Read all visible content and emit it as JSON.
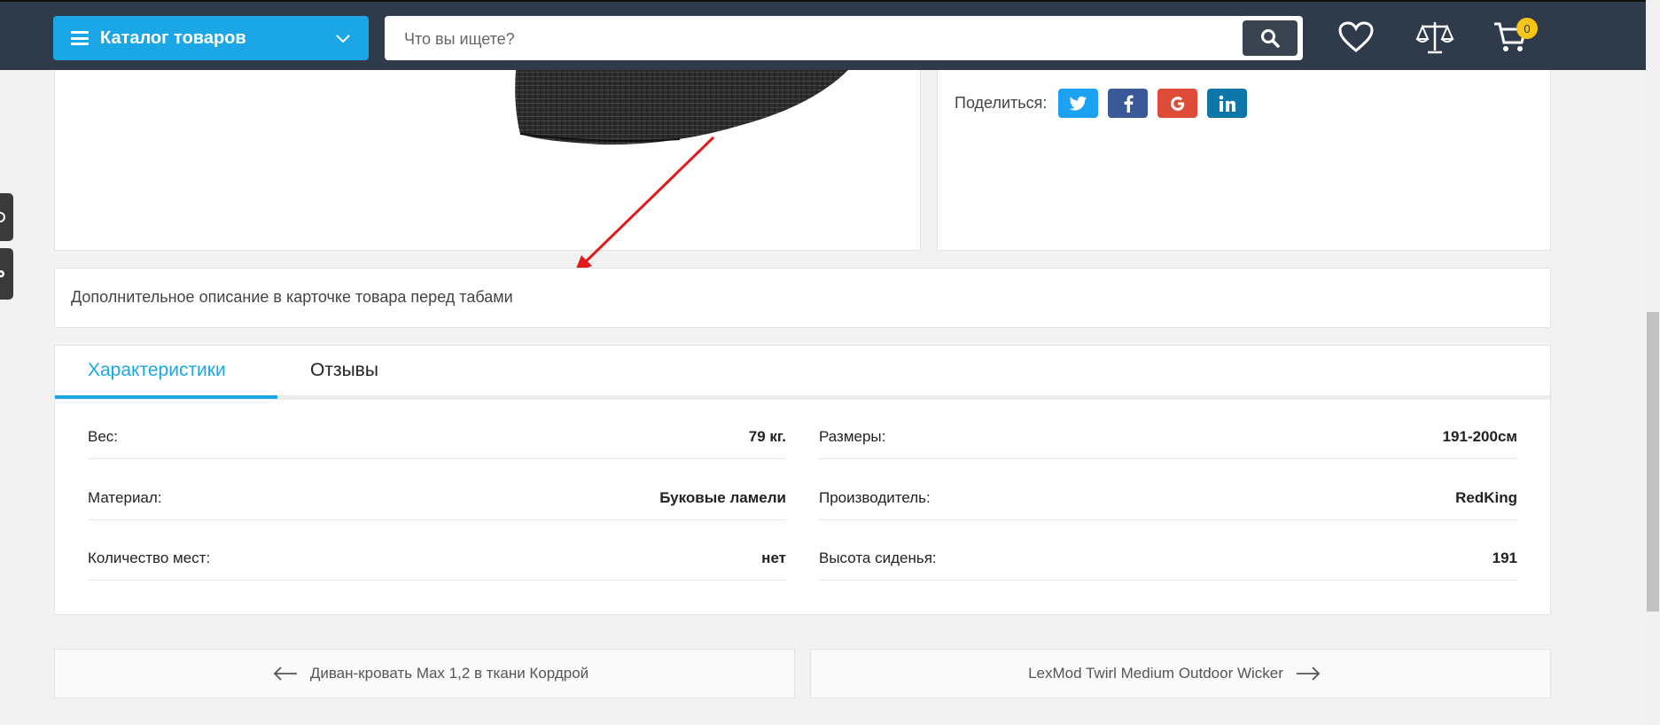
{
  "header": {
    "catalog_label": "Каталог товаров",
    "search_placeholder": "Что вы ищете?",
    "cart_count": "0",
    "accent_color": "#1ba7e6",
    "bg_color": "#2f3b4b",
    "icons": [
      "menu-icon",
      "chevron-down-icon",
      "search-icon",
      "heart-icon",
      "compare-scales-icon",
      "cart-icon"
    ]
  },
  "share": {
    "label": "Поделиться:",
    "buttons": [
      {
        "name": "twitter",
        "color": "#1da1f2"
      },
      {
        "name": "facebook",
        "color": "#3b5998"
      },
      {
        "name": "google",
        "color": "#dd4b39"
      },
      {
        "name": "linkedin",
        "color": "#0e76a8"
      }
    ]
  },
  "description": {
    "text": "Дополнительное описание в карточке товара перед табами"
  },
  "tabs": [
    {
      "label": "Характеристики",
      "active": true
    },
    {
      "label": "Отзывы",
      "active": false
    }
  ],
  "specs": {
    "left": [
      {
        "name": "Вес:",
        "value": "79 кг."
      },
      {
        "name": "Материал:",
        "value": "Буковые ламели"
      },
      {
        "name": "Количество мест:",
        "value": "нет"
      }
    ],
    "right": [
      {
        "name": "Размеры:",
        "value": "191-200см"
      },
      {
        "name": "Производитель:",
        "value": "RedKing"
      },
      {
        "name": "Высота сиденья:",
        "value": "191"
      }
    ]
  },
  "pager": {
    "prev": "Диван-кровать Max 1,2 в ткани Кордрой",
    "next": "LexMod Twirl Medium Outdoor Wicker"
  }
}
